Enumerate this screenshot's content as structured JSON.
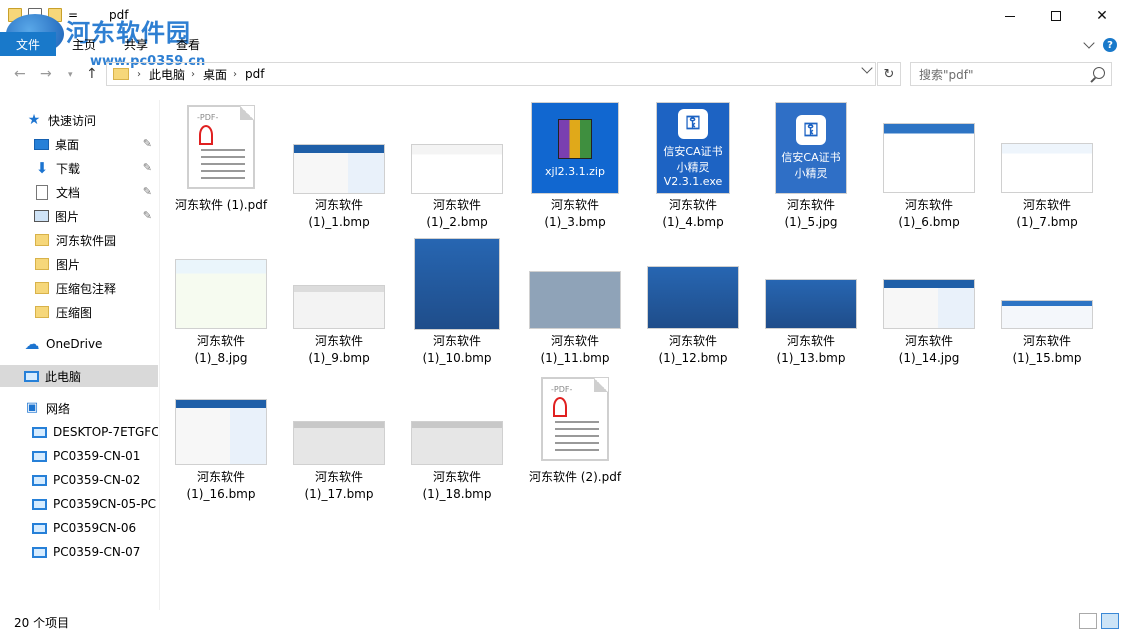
{
  "window": {
    "title": "pdf",
    "quick_access_dropdown": "=",
    "logo_text": "河东软件园",
    "logo_url": "www.pc0359.cn"
  },
  "ribbon": {
    "file_tab": "文件",
    "tabs": [
      "主页",
      "共享",
      "查看"
    ]
  },
  "address": {
    "crumbs": [
      "此电脑",
      "桌面",
      "pdf"
    ],
    "search_placeholder": "搜索\"pdf\""
  },
  "sidebar": {
    "items": [
      {
        "label": "快速访问",
        "icon": "star-icon"
      },
      {
        "label": "桌面",
        "icon": "desktop-icon",
        "pinned": true
      },
      {
        "label": "下载",
        "icon": "download-icon",
        "pinned": true
      },
      {
        "label": "文档",
        "icon": "document-icon",
        "pinned": true
      },
      {
        "label": "图片",
        "icon": "pictures-icon",
        "pinned": true
      },
      {
        "label": "河东软件园",
        "icon": "folder-icon"
      },
      {
        "label": "图片",
        "icon": "folder-icon"
      },
      {
        "label": "压缩包注释",
        "icon": "folder-icon"
      },
      {
        "label": "压缩图",
        "icon": "folder-icon"
      },
      {
        "label": "OneDrive",
        "icon": "cloud-icon"
      },
      {
        "label": "此电脑",
        "icon": "pc-icon",
        "selected": true
      },
      {
        "label": "网络",
        "icon": "network-icon"
      },
      {
        "label": "DESKTOP-7ETGFC",
        "icon": "computer-icon"
      },
      {
        "label": "PC0359-CN-01",
        "icon": "computer-icon"
      },
      {
        "label": "PC0359-CN-02",
        "icon": "computer-icon"
      },
      {
        "label": "PC0359CN-05-PC",
        "icon": "computer-icon"
      },
      {
        "label": "PC0359CN-06",
        "icon": "computer-icon"
      },
      {
        "label": "PC0359-CN-07",
        "icon": "computer-icon"
      }
    ]
  },
  "files": [
    {
      "line1": "河东软件 (1).pdf",
      "line2": "",
      "type": "pdf"
    },
    {
      "line1": "河东软件",
      "line2": "(1)_1.bmp",
      "type": "web"
    },
    {
      "line1": "河东软件",
      "line2": "(1)_2.bmp",
      "type": "dialog"
    },
    {
      "line1": "河东软件",
      "line2": "(1)_3.bmp",
      "type": "zip",
      "caption": "xjl2.3.1.zip"
    },
    {
      "line1": "河东软件",
      "line2": "(1)_4.bmp",
      "type": "app",
      "caption1": "信安CA证书",
      "caption2": "小精灵",
      "caption3": "V2.3.1.exe"
    },
    {
      "line1": "河东软件",
      "line2": "(1)_5.jpg",
      "type": "app2",
      "caption1": "信安CA证书",
      "caption2": "小精灵"
    },
    {
      "line1": "河东软件",
      "line2": "(1)_6.bmp",
      "type": "web"
    },
    {
      "line1": "河东软件",
      "line2": "(1)_7.bmp",
      "type": "web"
    },
    {
      "line1": "河东软件",
      "line2": "(1)_8.jpg",
      "type": "grid"
    },
    {
      "line1": "河东软件",
      "line2": "(1)_9.bmp",
      "type": "dialog"
    },
    {
      "line1": "河东软件",
      "line2": "(1)_10.bmp",
      "type": "login"
    },
    {
      "line1": "河东软件",
      "line2": "(1)_11.bmp",
      "type": "gray"
    },
    {
      "line1": "河东软件",
      "line2": "(1)_12.bmp",
      "type": "bluewide"
    },
    {
      "line1": "河东软件",
      "line2": "(1)_13.bmp",
      "type": "bluewide"
    },
    {
      "line1": "河东软件",
      "line2": "(1)_14.jpg",
      "type": "web"
    },
    {
      "line1": "河东软件",
      "line2": "(1)_15.bmp",
      "type": "thin"
    },
    {
      "line1": "河东软件",
      "line2": "(1)_16.bmp",
      "type": "web"
    },
    {
      "line1": "河东软件",
      "line2": "(1)_17.bmp",
      "type": "gray"
    },
    {
      "line1": "河东软件",
      "line2": "(1)_18.bmp",
      "type": "gray"
    },
    {
      "line1": "河东软件 (2).pdf",
      "line2": "",
      "type": "pdf"
    }
  ],
  "pdf_thumb_tag": "-PDF-",
  "status": {
    "count": "20 个项目"
  }
}
